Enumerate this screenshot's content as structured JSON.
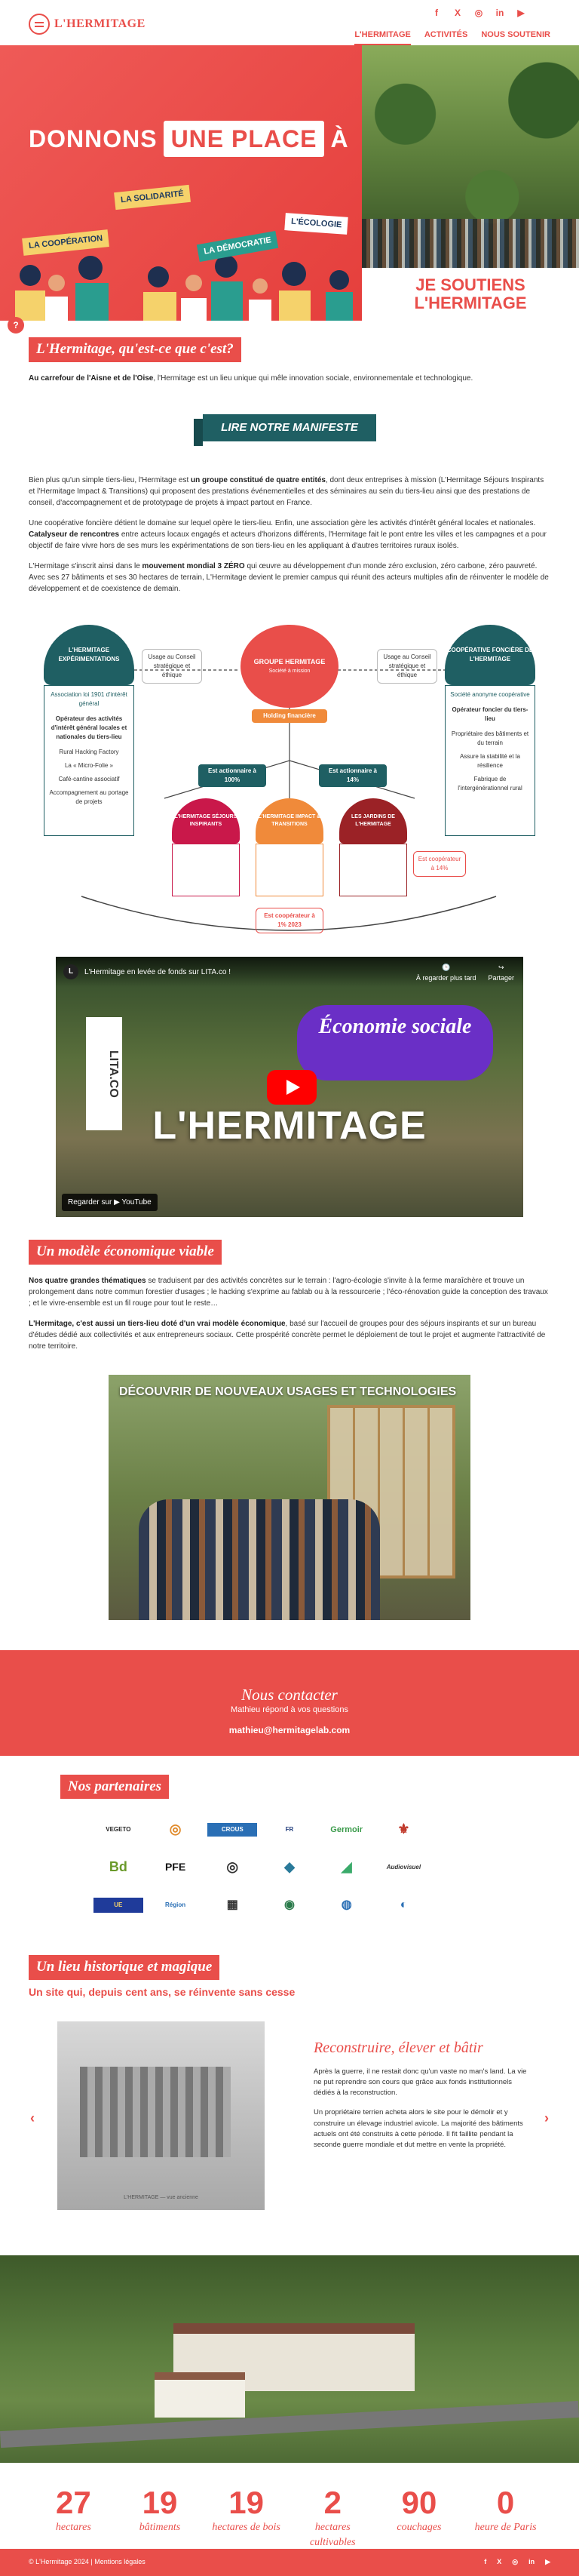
{
  "header": {
    "logo_text": "L'HERMITAGE",
    "socials": [
      "f",
      "X",
      "◎",
      "in",
      "▶"
    ],
    "nav": [
      "L'HERMITAGE",
      "ACTIVITÉS",
      "NOUS SOUTENIR"
    ]
  },
  "hero": {
    "title_pre": "DONNONS",
    "title_pill": "UNE PLACE",
    "title_post": "À",
    "signs": [
      "LA SOLIDARITÉ",
      "L'ÉCOLOGIE",
      "LA COOPÉRATION",
      "LA DÉMOCRATIE"
    ],
    "cta_line1": "JE SOUTIENS",
    "cta_line2": "L'HERMITAGE"
  },
  "intro": {
    "title": "L'Hermitage, qu'est-ce que c'est?",
    "lead_bold": "Au carrefour de l'Aisne et de l'Oise",
    "lead_rest": ", l'Hermitage est un lieu unique qui mêle innovation sociale, environnementale et technologique.",
    "manifeste_button": "LIRE NOTRE MANIFESTE",
    "p1_a": "Bien plus qu'un simple tiers-lieu, l'Hermitage est ",
    "p1_b": "un groupe constitué de quatre entités",
    "p1_c": ", dont deux entreprises à mission (L'Hermitage Séjours Inspirants et l'Hermitage Impact & Transitions) qui proposent des prestations événementielles et des séminaires au sein du tiers-lieu ainsi que des prestations de conseil, d'accompagnement et de prototypage de projets à impact partout en France.",
    "p2_a": "Une coopérative foncière détient le domaine sur lequel opère le tiers-lieu. Enfin, une association gère les activités d'intérêt général locales et nationales. ",
    "p2_b": "Catalyseur de rencontres",
    "p2_c": " entre acteurs locaux engagés et acteurs d'horizons différents, l'Hermitage fait le pont entre les villes et les campagnes et a pour objectif de faire vivre hors de ses murs les expérimentations de son tiers-lieu en les appliquant à d'autres territoires ruraux isolés.",
    "p3_a": "L'Hermitage s'inscrit ainsi dans le ",
    "p3_b": "mouvement mondial 3 ZÉRO",
    "p3_c": " qui œuvre au développement d'un monde zéro exclusion, zéro carbone, zéro pauvreté. Avec ses 27 bâtiments et ses 30 hectares de terrain, L'Hermitage devient le premier campus qui réunit des acteurs multiples afin de réinventer le modèle de développement et de coexistence de demain."
  },
  "diagram": {
    "left_title": "L'HERMITAGE EXPÉRIMENTATIONS",
    "left_sub": "Association loi 1901 d'intérêt général",
    "left_items": [
      "Opérateur des activités d'intérêt général locales et nationales du tiers-lieu",
      "Rural Hacking Factory",
      "La « Micro-Folie »",
      "Café-cantine associatif",
      "Accompagnement au portage de projets"
    ],
    "center_title": "GROUPE HERMITAGE",
    "center_sub": "Société à mission",
    "center_box": "Holding financière",
    "right_title": "COOPÉRATIVE FONCIÈRE DE L'HERMITAGE",
    "right_sub": "Société anonyme coopérative",
    "right_items": [
      "Opérateur foncier du tiers-lieu",
      "Propriétaire des bâtiments et du terrain",
      "Assure la stabilité et la résilience",
      "Fabrique de l'intergénérationnel rural"
    ],
    "tag_left_small": "Usage au Conseil stratégique et éthique",
    "tag_right_small": "Usage au Conseil stratégique et éthique",
    "pct_left": "Est actionnaire à 100%",
    "pct_right": "Est actionnaire à 14%",
    "bottom_left": "L'HERMITAGE SÉJOURS INSPIRANTS",
    "bottom_mid": "L'HERMITAGE IMPACT & TRANSITIONS",
    "bottom_right": "LES JARDINS DE L'HERMITAGE",
    "coop_left": "Est coopérateur à 14%",
    "coop_bottom": "Est coopérateur à 1% 2023"
  },
  "video": {
    "channel": "L'Hermitage en levée de fonds sur LITA.co !",
    "action_later": "À regarder plus tard",
    "action_share": "Partager",
    "bubble": "Économie sociale",
    "big_title": "L'HERMITAGE",
    "lita": "LITA.CO",
    "watch_on": "Regarder sur ▶ YouTube"
  },
  "model": {
    "title": "Un modèle économique viable",
    "p1_a": "Nos quatre grandes thématiques",
    "p1_b": " se traduisent par des activités concrètes sur le terrain : l'agro-écologie s'invite à la ferme maraîchère et trouve un prolongement dans notre commun forestier d'usages ; le hacking s'exprime au fablab ou à la ressourcerie ; l'éco-rénovation guide la conception des travaux ; et le vivre-ensemble est un fil rouge pour tout le reste…",
    "p2_a": "L'Hermitage, c'est aussi un tiers-lieu doté d'un vrai modèle économique",
    "p2_b": ", basé sur l'accueil de groupes pour des séjours inspirants et sur un bureau d'études dédié aux collectivités et aux entrepreneurs sociaux. Cette prospérité concrète permet le déploiement de tout le projet et augmente l'attractivité de notre territoire.",
    "photo_caption": "DÉCOUVRIR DE NOUVEAUX USAGES ET TECHNOLOGIES"
  },
  "contact": {
    "title": "Nous contacter",
    "sub": "Mathieu répond à vos questions",
    "email": "mathieu@hermitagelab.com"
  },
  "partners": {
    "title": "Nos partenaires",
    "logos": [
      "VEGETO",
      "◎",
      "CROUS",
      "FR",
      "Germoir",
      "⚜",
      "",
      "Bd",
      "PFE",
      "◎",
      "◆",
      "◢",
      "Audiovisuel",
      "",
      "UE",
      "Région",
      "▦",
      "◉",
      "◍",
      "◐",
      ""
    ]
  },
  "history": {
    "title": "Un lieu historique et magique",
    "subtitle": "Un site qui, depuis cent ans, se réinvente sans cesse",
    "slide_title": "Reconstruire, élever et bâtir",
    "slide_p1": "Après la guerre, il ne restait donc qu'un vaste no man's land. La vie ne put reprendre son cours que grâce aux fonds institutionnels dédiés à la reconstruction.",
    "slide_p2": "Un propriétaire terrien acheta alors le site pour le démolir et y construire un élevage industriel avicole. La majorité des bâtiments actuels ont été construits à cette période. Il fit faillite pendant la seconde guerre mondiale et dut mettre en vente la propriété.",
    "img_caption": "L'HERMITAGE — vue ancienne",
    "prev": "‹",
    "next": "›"
  },
  "stats": [
    {
      "num": "27",
      "lbl": "hectares"
    },
    {
      "num": "19",
      "lbl": "bâtiments"
    },
    {
      "num": "19",
      "lbl": "hectares de bois"
    },
    {
      "num": "2",
      "lbl": "hectares cultivables"
    },
    {
      "num": "90",
      "lbl": "couchages"
    },
    {
      "num": "0",
      "lbl": "heure de Paris"
    }
  ],
  "footer": {
    "text": "© L'Hermitage 2024 | Mentions légales",
    "socials": [
      "f",
      "X",
      "◎",
      "in",
      "▶"
    ]
  },
  "colors": {
    "accent": "#e94e4a",
    "teal": "#1f5f63"
  }
}
